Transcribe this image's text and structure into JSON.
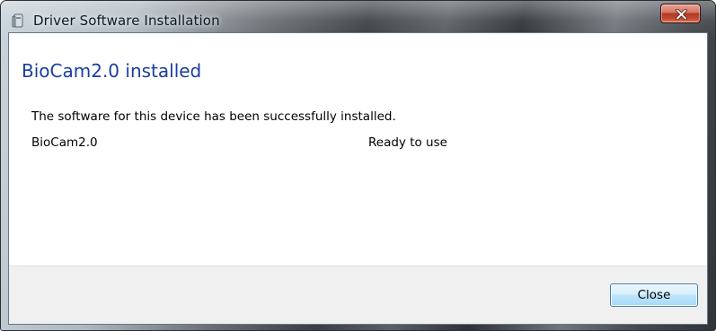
{
  "window": {
    "title": "Driver Software Installation",
    "title_icon": "driver-install-icon",
    "close_icon": "close-x-icon"
  },
  "content": {
    "heading": "BioCam2.0 installed",
    "message": "The software for this device has been successfully installed.",
    "device_name": "BioCam2.0",
    "device_status": "Ready to use"
  },
  "footer": {
    "close_label": "Close"
  },
  "colors": {
    "heading": "#1a3e9c",
    "footer_bg": "#f0f0f0",
    "close_button_border": "#3c7fb1",
    "titlebar_close": "#c04a33"
  }
}
